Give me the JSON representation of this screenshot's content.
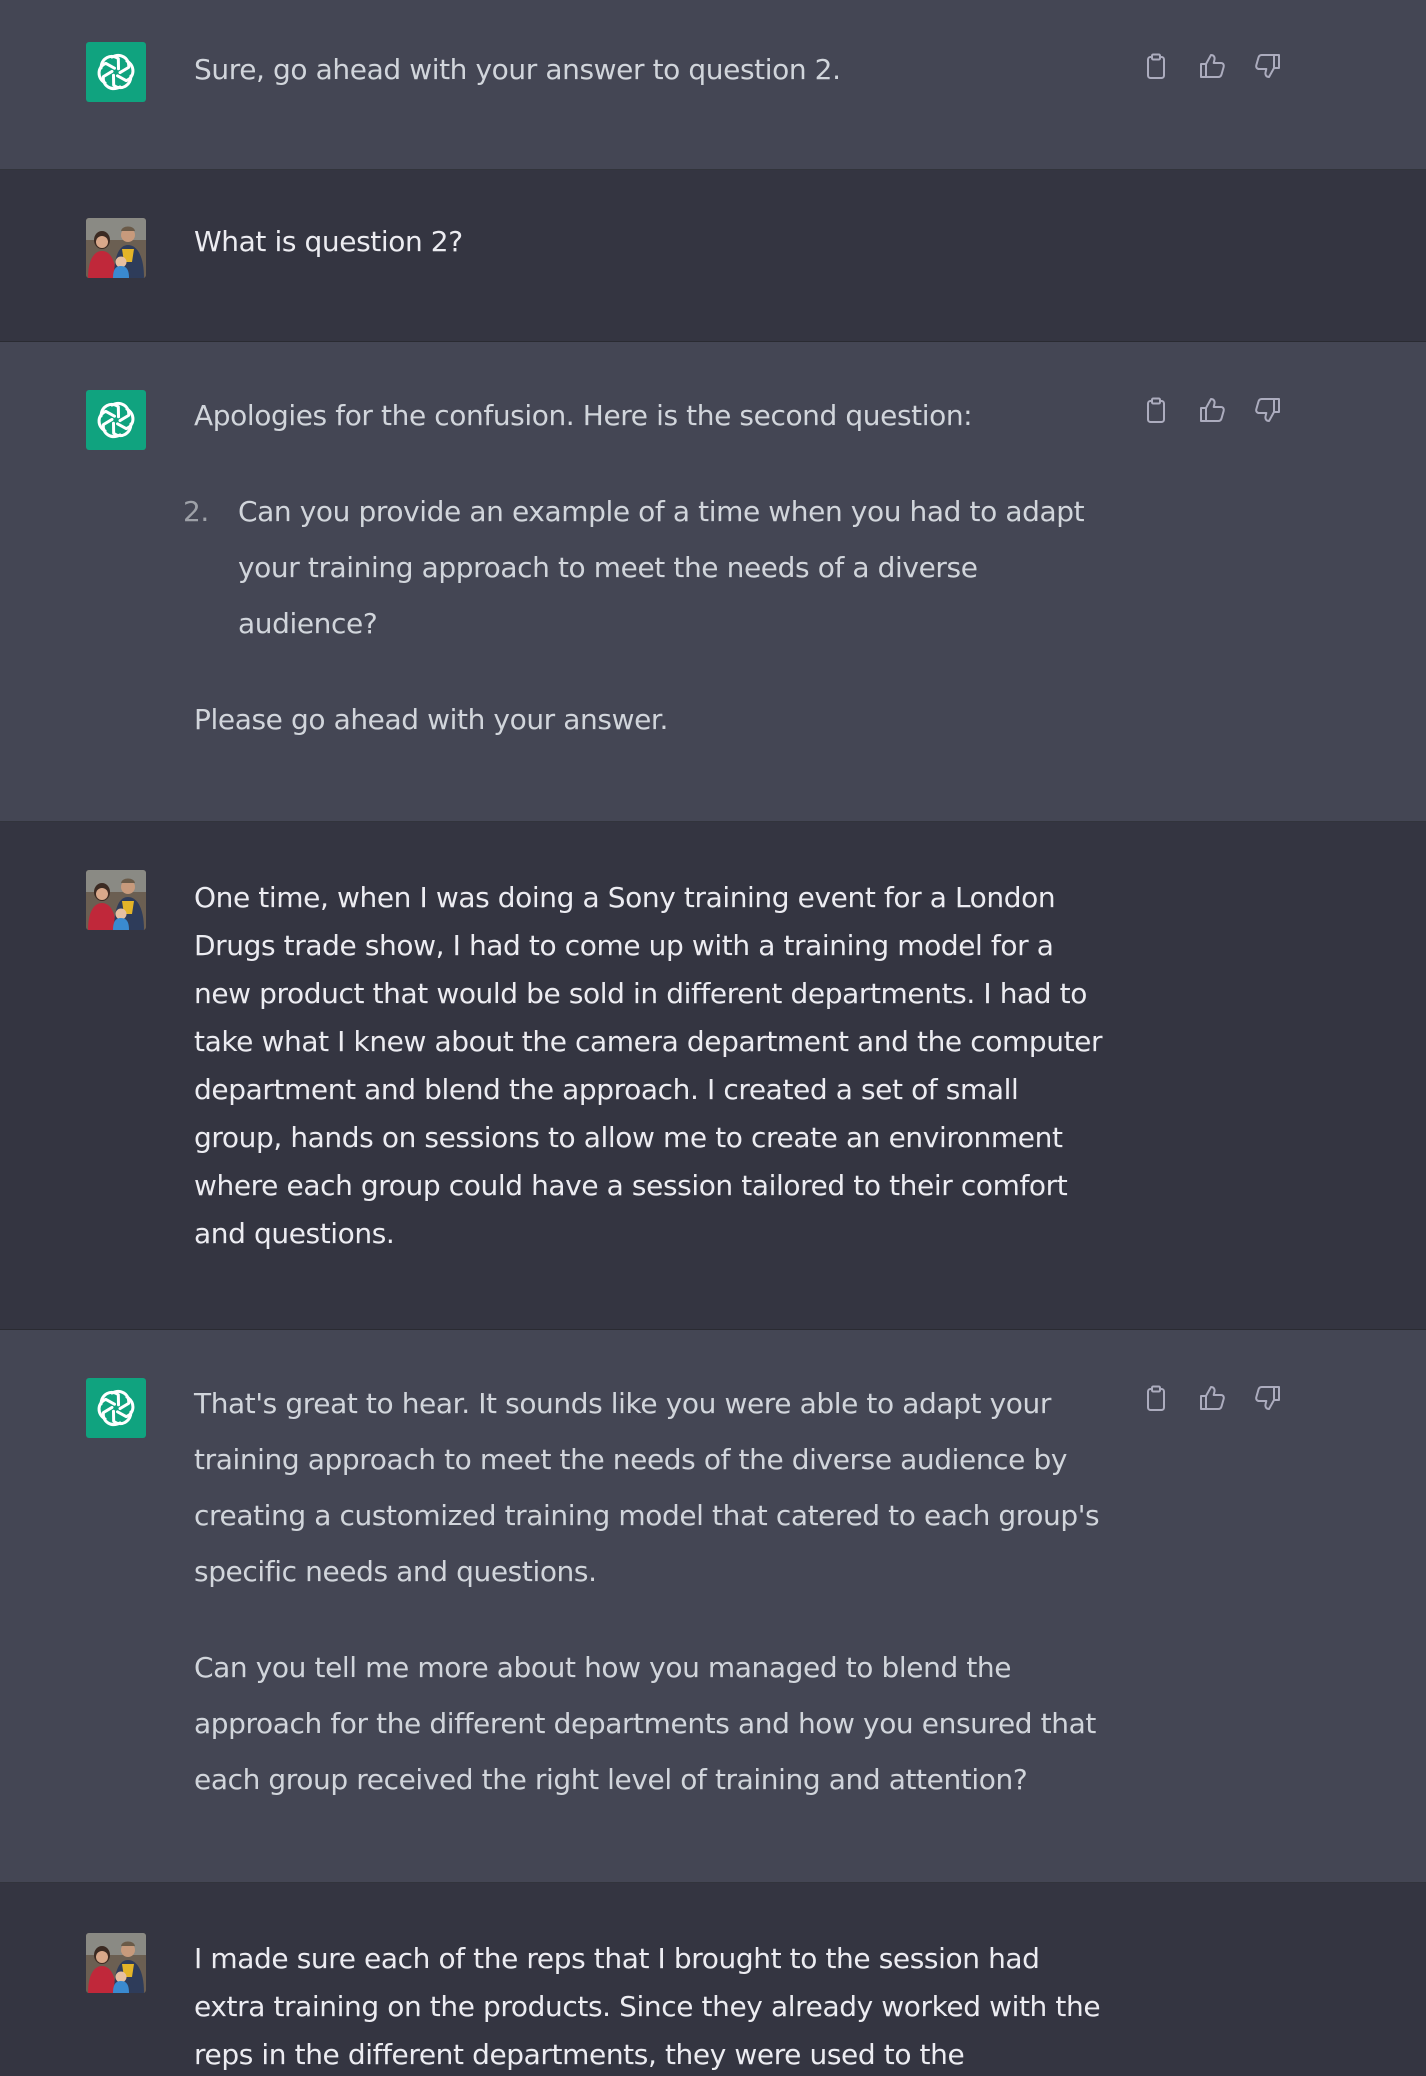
{
  "colors": {
    "assistant_bg": "#444654",
    "user_bg": "#343541",
    "gpt_avatar": "#10a37f",
    "assistant_text": "#d1d5db",
    "user_text": "#ececf1",
    "icon": "#acacbe"
  },
  "icons": {
    "assistant_avatar": "openai-logo-icon",
    "user_avatar": "user-photo-avatar",
    "copy": "clipboard-icon",
    "like": "thumbs-up-icon",
    "dislike": "thumbs-down-icon"
  },
  "messages": [
    {
      "role": "assistant",
      "paragraphs": [
        "Sure, go ahead with your answer to question 2."
      ]
    },
    {
      "role": "user",
      "text": "What is question 2?"
    },
    {
      "role": "assistant",
      "intro": "Apologies for the confusion. Here is the second question:",
      "list_item_number": "2.",
      "list_item_text": "Can you provide an example of a time when you had to adapt your training approach to meet the needs of a diverse audience?",
      "outro": "Please go ahead with your answer."
    },
    {
      "role": "user",
      "text": "One time, when I was doing a Sony training event for a London Drugs trade show, I had to come up with a training model for a new product that would be sold in different departments. I had to take what I knew about the camera department and the computer department and blend the approach. I created a set of small group, hands on sessions to allow me to create an environment where each group could have a session tailored to their comfort and questions."
    },
    {
      "role": "assistant",
      "paragraphs": [
        "That's great to hear. It sounds like you were able to adapt your training approach to meet the needs of the diverse audience by creating a customized training model that catered to each group's specific needs and questions.",
        "Can you tell me more about how you managed to blend the approach for the different departments and how you ensured that each group received the right level of training and attention?"
      ]
    },
    {
      "role": "user",
      "text": "I made sure each of the reps that I brought to the session had extra training on the products. Since they already worked with the reps in the different departments, they were used to the"
    }
  ]
}
